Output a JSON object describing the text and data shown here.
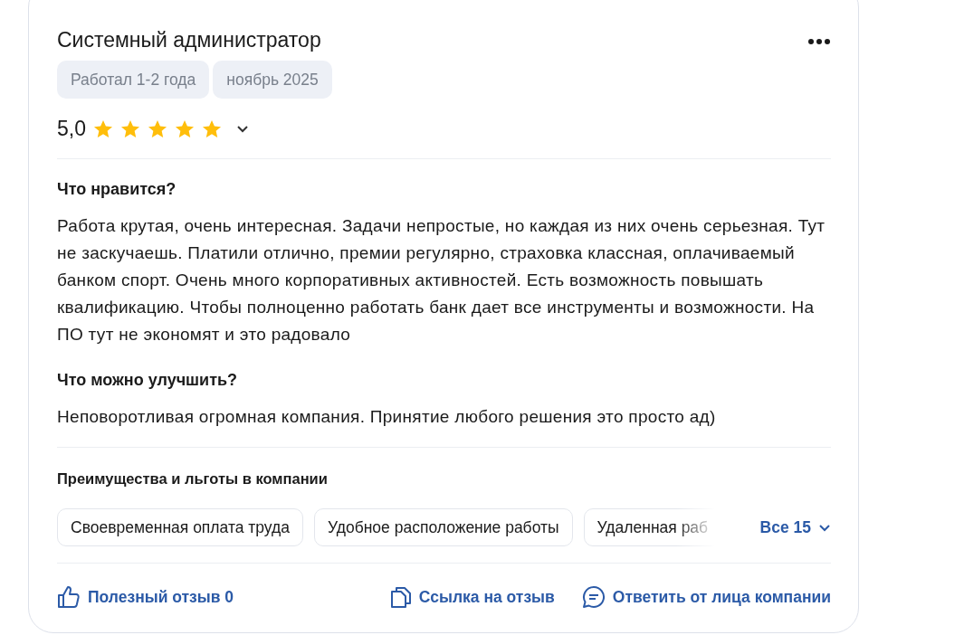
{
  "review": {
    "title": "Системный администратор",
    "tags": [
      "Работал 1-2 года",
      "ноябрь 2025"
    ],
    "rating": {
      "value": "5,0",
      "stars": 5
    },
    "sections": [
      {
        "heading": "Что нравится?",
        "text": "Работа крутая, очень интересная. Задачи непростые, но каждая из них очень серьезная. Тут не заскучаешь. Платили отлично, премии регулярно, страховка классная, оплачиваемый банком спорт. Очень много корпоративных активностей. Есть возможность повышать квалификацию. Чтобы полноценно работать банк дает все инструменты и возможности. На ПО тут не экономят и это радовало"
      },
      {
        "heading": "Что можно улучшить?",
        "text": "Неповоротливая огромная компания. Принятие любого решения это просто ад)"
      }
    ],
    "benefits": {
      "heading": "Преимущества и льготы в компании",
      "items": [
        "Своевременная оплата труда",
        "Удобное расположение работы",
        "Удаленная раб"
      ],
      "all_label": "Все 15"
    },
    "actions": [
      {
        "kind": "like",
        "label": "Полезный отзыв 0"
      },
      {
        "kind": "link",
        "label": "Ссылка на отзыв"
      },
      {
        "kind": "reply",
        "label": "Ответить от лица компании"
      }
    ]
  }
}
